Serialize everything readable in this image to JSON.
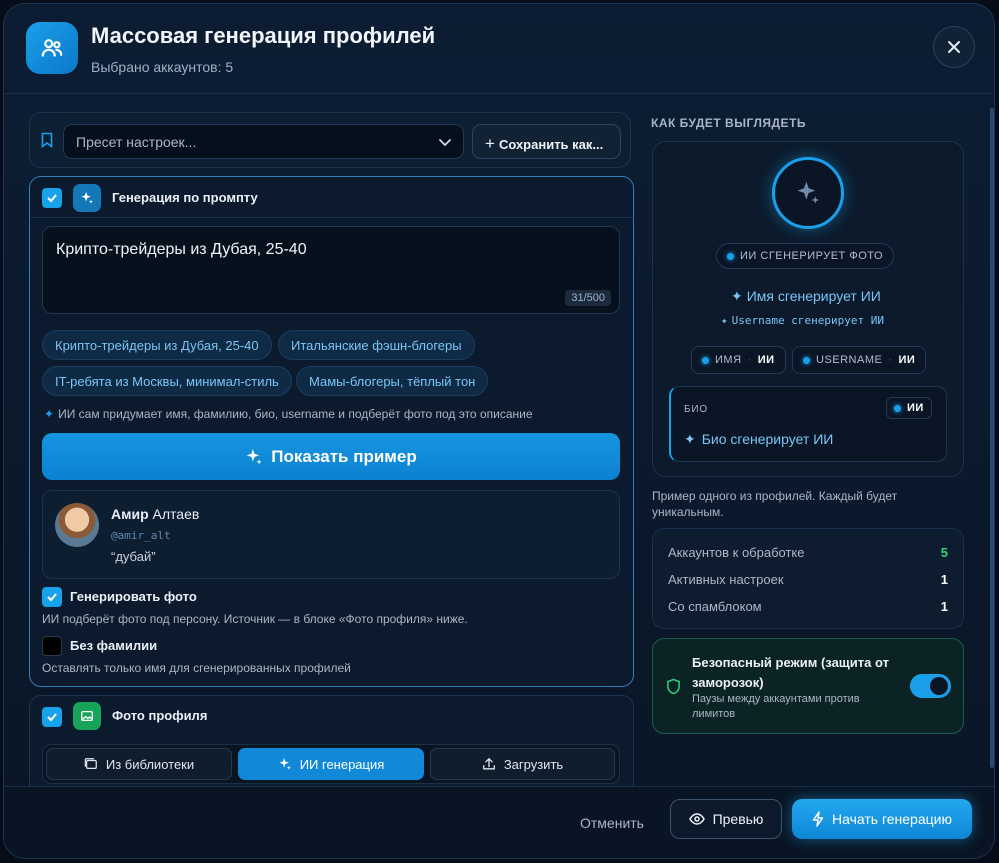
{
  "header": {
    "title": "Массовая генерация профилей",
    "subtitle": "Выбрано аккаунтов: 5",
    "icon": "users-icon"
  },
  "preset": {
    "placeholder": "Пресет настроек...",
    "save_label": "Сохранить как..."
  },
  "prompt_section": {
    "title": "Генерация по промпту",
    "enabled": true,
    "prompt_value": "Крипто-трейдеры из Дубая, 25-40",
    "counter": "31/500",
    "chips": [
      "Крипто-трейдеры из Дубая, 25-40",
      "Итальянские фэшн-блогеры",
      "IT-ребята из Москвы, минимал-стиль",
      "Мамы-блогеры, тёплый тон"
    ],
    "hint": "ИИ сам придумает имя, фамилию, био, username и подберёт фото под это описание",
    "show_example_label": "Показать пример",
    "example": {
      "first_name": "Амир",
      "last_name": "Алтаев",
      "username": "@amir_alt",
      "bio": "“дубай”"
    },
    "generate_photo": {
      "label": "Генерировать фото",
      "checked": true,
      "desc": "ИИ подберёт фото под персону. Источник — в блоке «Фото профиля» ниже."
    },
    "no_last_name": {
      "label": "Без фамилии",
      "checked": false,
      "desc": "Оставлять только имя для сгенерированных профилей"
    }
  },
  "photo_section": {
    "title": "Фото профиля",
    "enabled": true,
    "tabs": [
      {
        "label": "Из библиотеки",
        "active": false
      },
      {
        "label": "ИИ генерация",
        "active": true
      },
      {
        "label": "Загрузить",
        "active": false
      }
    ]
  },
  "preview": {
    "label": "КАК БУДЕТ ВЫГЛЯДЕТЬ",
    "photo_pill": "ИИ СГЕНЕРИРУЕТ ФОТО",
    "name_line": "Имя сгенерирует ИИ",
    "username_line": "Username сгенерирует ИИ",
    "name_tag": {
      "key": "ИМЯ",
      "value": "ИИ"
    },
    "username_tag": {
      "key": "USERNAME",
      "value": "ИИ"
    },
    "bio_label": "БИО",
    "bio_tag": "ИИ",
    "bio_line": "Био сгенерирует ИИ",
    "caption": "Пример одного из профилей. Каждый будет уникальным."
  },
  "stats": [
    {
      "label": "Аккаунтов к обработке",
      "value": "5"
    },
    {
      "label": "Активных настроек",
      "value": "1"
    },
    {
      "label": "Со спамблоком",
      "value": "1"
    }
  ],
  "safe_mode": {
    "title": "Безопасный режим (защита от заморозок)",
    "desc": "Паузы между аккаунтами против лимитов",
    "on": true
  },
  "footer": {
    "cancel_label": "Отменить",
    "preview_label": "Превью",
    "start_label": "Начать генерацию"
  },
  "colors": {
    "accent": "#1aa0ea",
    "success": "#2bd67b",
    "background": "#0a1627"
  }
}
